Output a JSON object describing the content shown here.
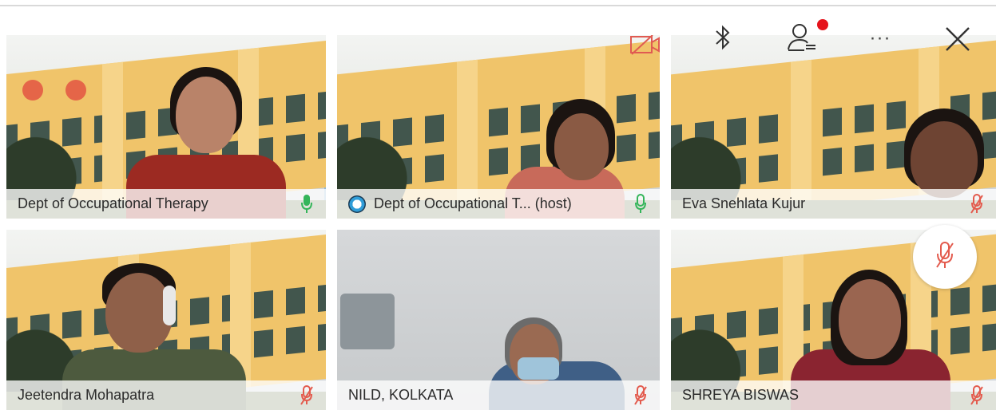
{
  "participants": [
    {
      "name": "Dept of Occupational Therapy",
      "mic": "on"
    },
    {
      "name": "Dept of Occupational T... (host)",
      "mic": "on-outline",
      "host": true
    },
    {
      "name": "Eva Snehlata Kujur",
      "mic": "muted"
    },
    {
      "name": "Jeetendra Mohapatra",
      "mic": "muted"
    },
    {
      "name": "NILD, KOLKATA",
      "mic": "muted"
    },
    {
      "name": "SHREYA BISWAS",
      "mic": "muted"
    }
  ],
  "toolbar": {
    "icons": [
      "video-off-icon",
      "bluetooth-icon",
      "participants-icon",
      "more-icon",
      "close-icon"
    ],
    "more_label": "···"
  },
  "colors": {
    "mic_on": "#34b55a",
    "mic_muted": "#e35b4e",
    "notification": "#e5131b",
    "video_off": "#e05b52"
  }
}
